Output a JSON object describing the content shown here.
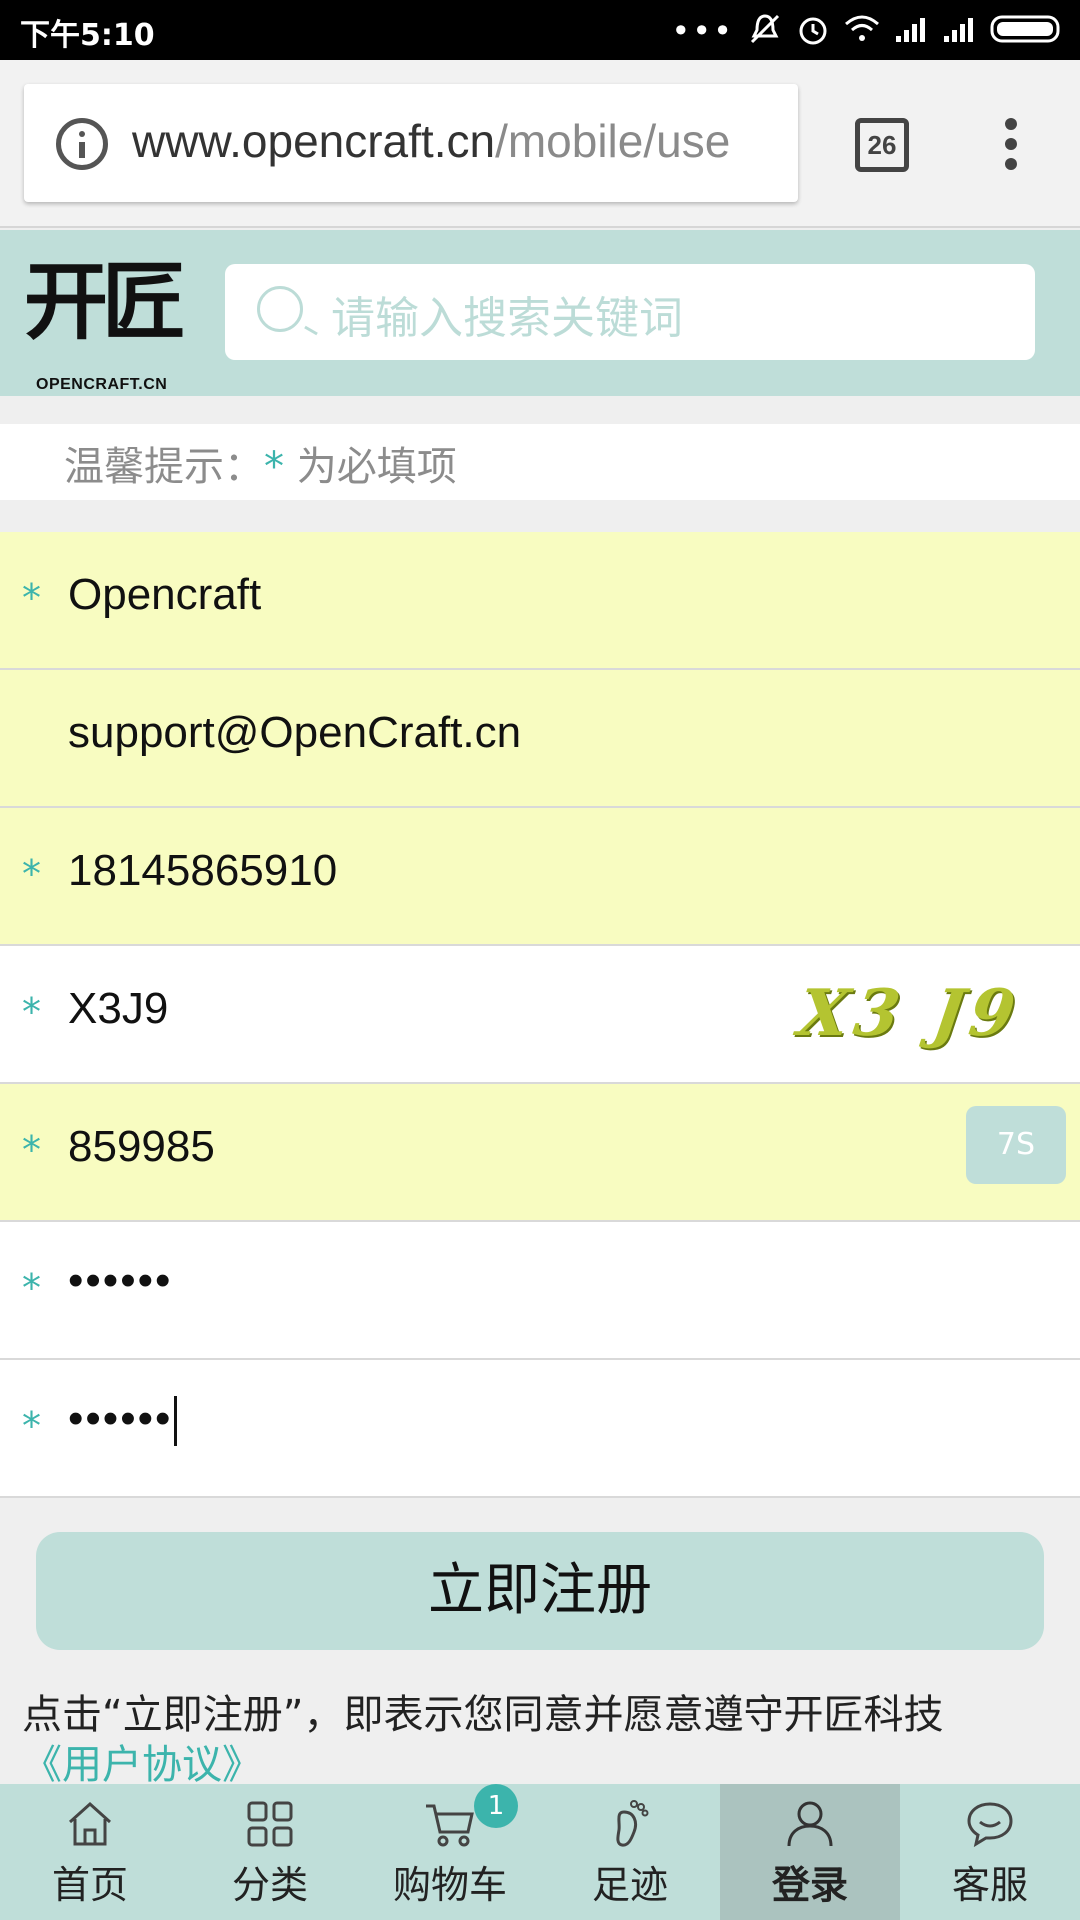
{
  "status_bar": {
    "time": "下午5:10"
  },
  "browser": {
    "url_host": "www.opencraft.cn",
    "url_path": "/mobile/use",
    "tab_count": "26"
  },
  "site_header": {
    "logo_mark": "开匠",
    "logo_sub": "OPENCRAFT.CN",
    "search_placeholder": "请输入搜索关键词"
  },
  "tip": {
    "prefix": "温馨提示：",
    "star": "*",
    "suffix": " 为必填项"
  },
  "form": {
    "required_mark": "*",
    "fields": [
      {
        "value": "Opencraft",
        "required": true
      },
      {
        "value": "support@OpenCraft.cn",
        "required": false
      },
      {
        "value": "18145865910",
        "required": true
      },
      {
        "value": "X3J9",
        "required": true,
        "captcha_image": "X3 J9"
      },
      {
        "value": "859985",
        "required": true,
        "countdown": "7S"
      },
      {
        "value": "••••••",
        "required": true
      },
      {
        "value": "••••••",
        "required": true
      }
    ]
  },
  "register_button": "立即注册",
  "agreement": {
    "text": "点击“立即注册”，即表示您同意并愿意遵守开匠科技",
    "link": "《用户协议》"
  },
  "bottom_nav": {
    "items": [
      {
        "label": "首页",
        "icon": "home-icon"
      },
      {
        "label": "分类",
        "icon": "grid-icon"
      },
      {
        "label": "购物车",
        "icon": "cart-icon",
        "badge": "1"
      },
      {
        "label": "足迹",
        "icon": "footprint-icon"
      },
      {
        "label": "登录",
        "icon": "user-icon",
        "active": true
      },
      {
        "label": "客服",
        "icon": "chat-icon"
      }
    ]
  },
  "colors": {
    "accent": "#3cb4ac",
    "header_bg": "#bfded9",
    "field_yellow": "#f8fcc1"
  }
}
